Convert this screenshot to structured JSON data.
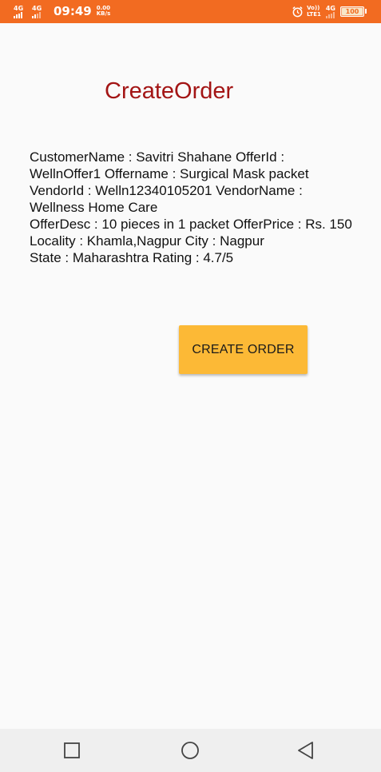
{
  "status_bar": {
    "network_1": "4G",
    "network_2": "4G",
    "time": "09:49",
    "speed_value": "0.00",
    "speed_unit": "KB/s",
    "volte_top": "Vo))",
    "volte_bottom": "LTE1",
    "network_right": "4G",
    "battery": "100",
    "icons": [
      "signal-icon",
      "alarm-icon",
      "battery-icon"
    ]
  },
  "page": {
    "title": "CreateOrder",
    "title_color": "#a31515"
  },
  "order_details": {
    "line1": "CustomerName : Savitri Shahane OfferId : WellnOffer1 Offername : Surgical Mask packet",
    "line2": "VendorId : Welln12340105201 VendorName : Wellness Home Care",
    "line3": "OfferDesc : 10 pieces in 1 packet OfferPrice : Rs. 150",
    "line4": "Locality : Khamla,Nagpur City : Nagpur",
    "line5": "State : Maharashtra Rating : 4.7/5"
  },
  "actions": {
    "create_order_label": "CREATE ORDER",
    "button_color": "#fcb936"
  },
  "nav_bar": {
    "icons": [
      "recents-square-icon",
      "home-circle-icon",
      "back-triangle-icon"
    ]
  },
  "colors": {
    "status_bar": "#f26b21",
    "background": "#fafafa"
  }
}
